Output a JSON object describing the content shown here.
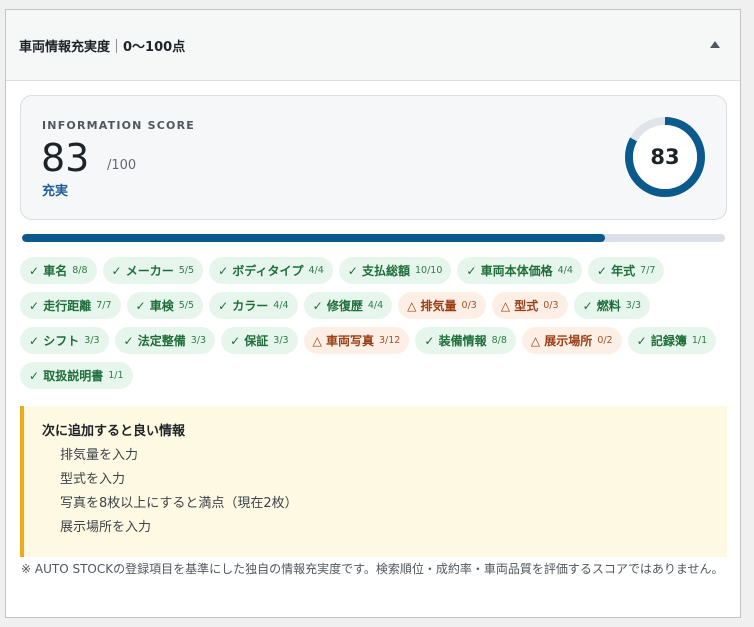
{
  "panel": {
    "title": "車両情報充実度",
    "subtitle": "0〜100点"
  },
  "score": {
    "label": "INFORMATION SCORE",
    "value": "83",
    "max": "/100",
    "rating": "充実",
    "fraction": 0.83,
    "colors": {
      "accent": "#0a5a8c",
      "track": "#e1e4eb"
    }
  },
  "chips": [
    {
      "label": "✓ 車名",
      "count": "8/8",
      "status": "ok"
    },
    {
      "label": "✓ メーカー",
      "count": "5/5",
      "status": "ok"
    },
    {
      "label": "✓ ボディタイプ",
      "count": "4/4",
      "status": "ok"
    },
    {
      "label": "✓ 支払総額",
      "count": "10/10",
      "status": "ok"
    },
    {
      "label": "✓ 車両本体価格",
      "count": "4/4",
      "status": "ok"
    },
    {
      "label": "✓ 年式",
      "count": "7/7",
      "status": "ok"
    },
    {
      "label": "✓ 走行距離",
      "count": "7/7",
      "status": "ok"
    },
    {
      "label": "✓ 車検",
      "count": "5/5",
      "status": "ok"
    },
    {
      "label": "✓ カラー",
      "count": "4/4",
      "status": "ok"
    },
    {
      "label": "✓ 修復歴",
      "count": "4/4",
      "status": "ok"
    },
    {
      "label": "△ 排気量",
      "count": "0/3",
      "status": "warn"
    },
    {
      "label": "△ 型式",
      "count": "0/3",
      "status": "warn"
    },
    {
      "label": "✓ 燃料",
      "count": "3/3",
      "status": "ok"
    },
    {
      "label": "✓ シフト",
      "count": "3/3",
      "status": "ok"
    },
    {
      "label": "✓ 法定整備",
      "count": "3/3",
      "status": "ok"
    },
    {
      "label": "✓ 保証",
      "count": "3/3",
      "status": "ok"
    },
    {
      "label": "△ 車両写真",
      "count": "3/12",
      "status": "warn"
    },
    {
      "label": "✓ 装備情報",
      "count": "8/8",
      "status": "ok"
    },
    {
      "label": "△ 展示場所",
      "count": "0/2",
      "status": "warn"
    },
    {
      "label": "✓ 記録簿",
      "count": "1/1",
      "status": "ok"
    },
    {
      "label": "✓ 取扱説明書",
      "count": "1/1",
      "status": "ok"
    }
  ],
  "suggestions": {
    "title": "次に追加すると良い情報",
    "items": [
      "排気量を入力",
      "型式を入力",
      "写真を8枚以上にすると満点（現在2枚）",
      "展示場所を入力"
    ]
  },
  "footnote": "※ AUTO STOCKの登録項目を基準にした独自の情報充実度です。検索順位・成約率・車両品質を評価するスコアではありません。",
  "icons": {
    "toggle": "collapse-arrow-up-icon"
  }
}
